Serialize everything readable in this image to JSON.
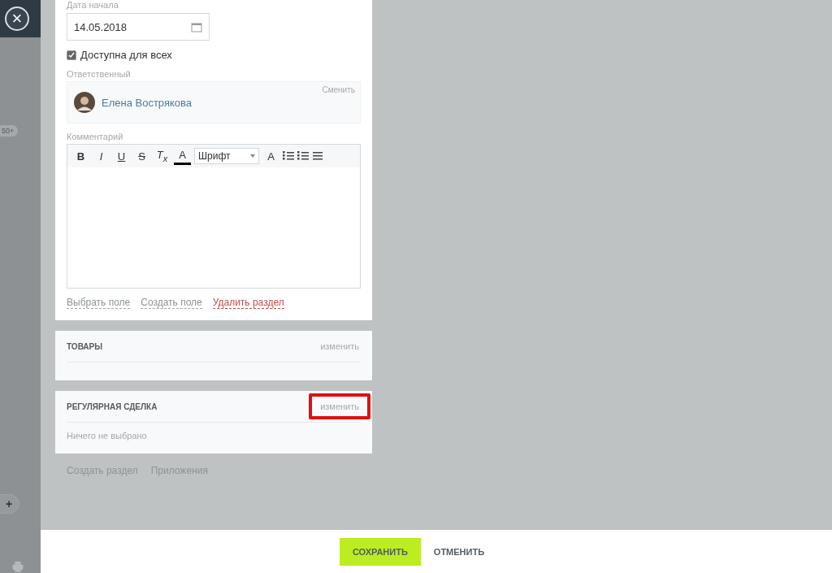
{
  "left_rail": {
    "badge": "50+",
    "add_button": "+"
  },
  "close_button": "×",
  "form": {
    "date_label": "Дата начала",
    "date_value": "14.05.2018",
    "public_checkbox": {
      "label": "Доступна для всех",
      "checked": true
    },
    "responsible_label": "Ответственный",
    "responsible_name": "Елена Вострякова",
    "change_link": "Сменить",
    "comment_label": "Комментарий",
    "toolbar": [
      {
        "kind": "text",
        "text": "B"
      },
      {
        "kind": "text",
        "text": "I"
      },
      {
        "kind": "text",
        "text": "U"
      },
      {
        "kind": "text",
        "text": "S"
      },
      {
        "kind": "text",
        "text": "T$_{x}$"
      },
      {
        "kind": "text",
        "text": "A"
      },
      {
        "kind": "select",
        "text": "Шрифт"
      },
      {
        "kind": "text",
        "text": "A"
      },
      {
        "kind": "icon"
      },
      {
        "kind": "icon"
      },
      {
        "kind": "icon"
      }
    ],
    "links": [
      {
        "text": "Выбрать поле",
        "danger": false
      },
      {
        "text": "Создать поле",
        "danger": false
      },
      {
        "text": "Удалить раздел",
        "danger": true
      }
    ]
  },
  "sections": [
    {
      "title": "ТОВАРЫ",
      "action": "изменить",
      "highlighted": false
    },
    {
      "title": "РЕГУЛЯРНАЯ СДЕЛКА",
      "action": "изменить",
      "highlighted": true,
      "note": "Ничего не выбрано"
    }
  ],
  "bottom_links": [
    "Создать раздел",
    "Приложения"
  ],
  "footer": {
    "save": "СОХРАНИТЬ",
    "cancel": "ОТМЕНИТЬ"
  }
}
